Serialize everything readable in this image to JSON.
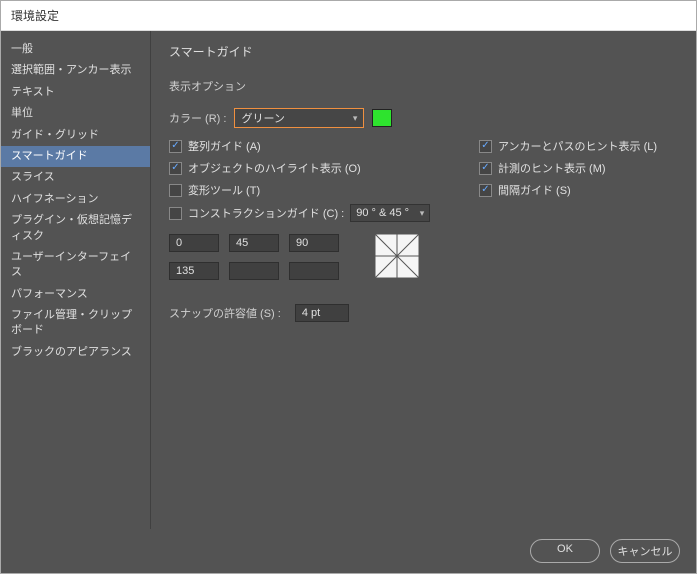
{
  "window": {
    "title": "環境設定"
  },
  "sidebar": {
    "items": [
      {
        "label": "一般"
      },
      {
        "label": "選択範囲・アンカー表示"
      },
      {
        "label": "テキスト"
      },
      {
        "label": "単位"
      },
      {
        "label": "ガイド・グリッド"
      },
      {
        "label": "スマートガイド"
      },
      {
        "label": "スライス"
      },
      {
        "label": "ハイフネーション"
      },
      {
        "label": "プラグイン・仮想記憶ディスク"
      },
      {
        "label": "ユーザーインターフェイス"
      },
      {
        "label": "パフォーマンス"
      },
      {
        "label": "ファイル管理・クリップボード"
      },
      {
        "label": "ブラックのアピアランス"
      }
    ],
    "selected_index": 5
  },
  "main": {
    "panel_title": "スマートガイド",
    "group": "表示オプション",
    "color_label": "カラー (R) :",
    "color_value": "グリーン",
    "color_swatch": "#2ee32e",
    "checks_left": [
      {
        "label": "整列ガイド (A)",
        "checked": true
      },
      {
        "label": "オブジェクトのハイライト表示 (O)",
        "checked": true
      },
      {
        "label": "変形ツール (T)",
        "checked": false
      },
      {
        "label": "コンストラクションガイド (C) :",
        "checked": false
      }
    ],
    "checks_right": [
      {
        "label": "アンカーとパスのヒント表示 (L)",
        "checked": true
      },
      {
        "label": "計測のヒント表示 (M)",
        "checked": true
      },
      {
        "label": "間隔ガイド (S)",
        "checked": true
      }
    ],
    "construction_preset": "90 °  & 45 °",
    "angles": [
      "0",
      "45",
      "90",
      "135",
      "",
      ""
    ],
    "snap_label": "スナップの許容値 (S) :",
    "snap_value": "4 pt"
  },
  "footer": {
    "ok": "OK",
    "cancel": "キャンセル"
  }
}
